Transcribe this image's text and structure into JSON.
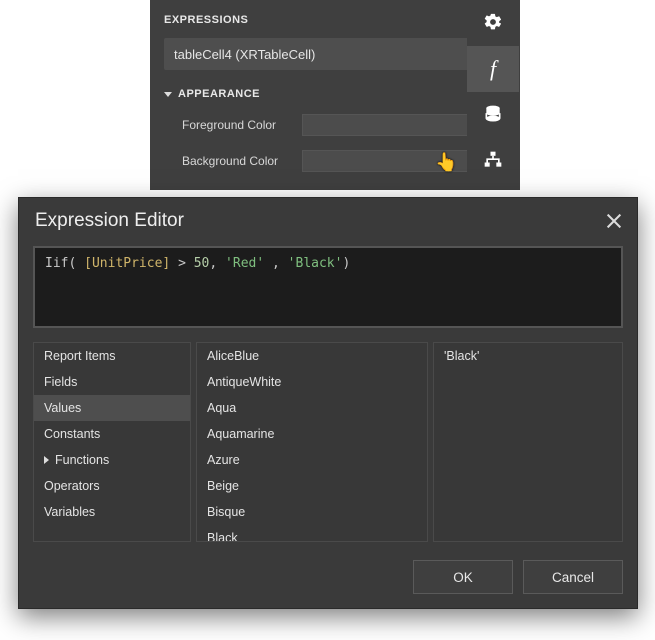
{
  "panel": {
    "title": "EXPRESSIONS",
    "dropdown_label": "tableCell4 (XRTableCell)",
    "section": "APPEARANCE",
    "props": {
      "fg_label": "Foreground Color",
      "bg_label": "Background Color"
    },
    "ellipsis": "..."
  },
  "toolbar": {
    "icons": [
      "gear",
      "fx",
      "database",
      "sitemap"
    ]
  },
  "dialog": {
    "title": "Expression Editor",
    "code": {
      "kw": "Iif",
      "open": "(",
      "br_open": " [",
      "field": "UnitPrice",
      "br_close": "] ",
      "op": "> ",
      "num": "50",
      "comma1": ", ",
      "str1": "'Red'",
      "comma2": " , ",
      "str2": "'Black'",
      "close": ")"
    },
    "categories": [
      {
        "label": "Report Items",
        "expandable": false
      },
      {
        "label": "Fields",
        "expandable": false
      },
      {
        "label": "Values",
        "expandable": false,
        "selected": true
      },
      {
        "label": "Constants",
        "expandable": false
      },
      {
        "label": "Functions",
        "expandable": true
      },
      {
        "label": "Operators",
        "expandable": false
      },
      {
        "label": "Variables",
        "expandable": false
      }
    ],
    "values": [
      "AliceBlue",
      "AntiqueWhite",
      "Aqua",
      "Aquamarine",
      "Azure",
      "Beige",
      "Bisque",
      "Black"
    ],
    "description": "'Black'",
    "ok": "OK",
    "cancel": "Cancel"
  }
}
